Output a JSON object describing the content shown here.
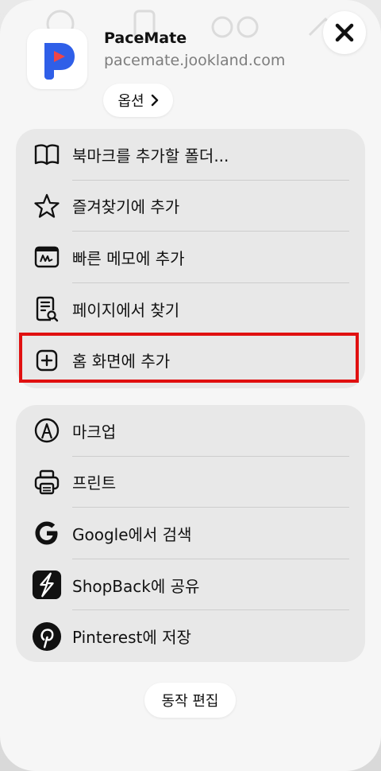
{
  "app": {
    "name": "PaceMate",
    "url": "pacemate.jookland.com",
    "options_label": "옵션"
  },
  "group1": [
    {
      "label": "북마크를 추가할 폴더...",
      "icon": "book-icon"
    },
    {
      "label": "즐겨찾기에 추가",
      "icon": "star-icon"
    },
    {
      "label": "빠른 메모에 추가",
      "icon": "quick-note-icon"
    },
    {
      "label": "페이지에서 찾기",
      "icon": "find-in-page-icon"
    },
    {
      "label": "홈 화면에 추가",
      "icon": "add-square-icon"
    }
  ],
  "group2": [
    {
      "label": "마크업",
      "icon": "markup-pen-icon"
    },
    {
      "label": "프린트",
      "icon": "printer-icon"
    },
    {
      "label": "Google에서 검색",
      "icon": "google-icon"
    },
    {
      "label": "ShopBack에 공유",
      "icon": "shopback-icon"
    },
    {
      "label": "Pinterest에 저장",
      "icon": "pinterest-icon"
    }
  ],
  "edit_actions_label": "동작 편집",
  "colors": {
    "highlight": "#e01010",
    "app_icon_blue": "#2f5fe8",
    "app_icon_red": "#f04545"
  }
}
